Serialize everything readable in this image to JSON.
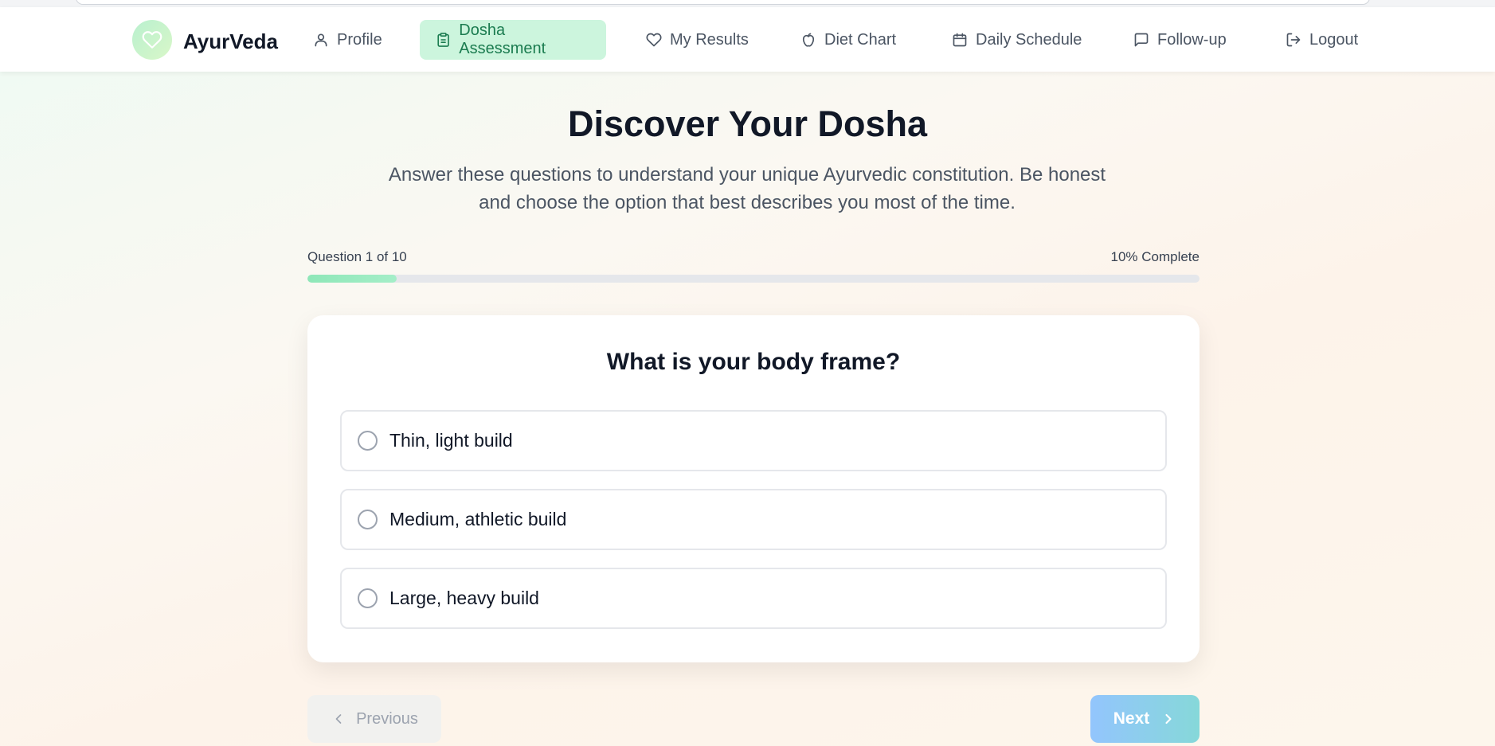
{
  "app": {
    "name": "AyurVeda"
  },
  "nav": {
    "items": [
      {
        "label": "Profile",
        "icon": "user-icon"
      },
      {
        "label": "Dosha Assessment",
        "icon": "clipboard-icon",
        "active": true
      },
      {
        "label": "My Results",
        "icon": "heart-icon"
      },
      {
        "label": "Diet Chart",
        "icon": "apple-icon"
      },
      {
        "label": "Daily Schedule",
        "icon": "calendar-icon"
      },
      {
        "label": "Follow-up",
        "icon": "message-icon"
      },
      {
        "label": "Logout",
        "icon": "logout-icon"
      }
    ]
  },
  "page": {
    "title": "Discover Your Dosha",
    "subtitle": "Answer these questions to understand your unique Ayurvedic constitution. Be honest and choose the option that best describes you most of the time."
  },
  "progress": {
    "question_label": "Question 1 of 10",
    "percent_label": "10% Complete",
    "fraction": 0.1
  },
  "question": {
    "text": "What is your body frame?",
    "options": [
      {
        "label": "Thin, light build"
      },
      {
        "label": "Medium, athletic build"
      },
      {
        "label": "Large, heavy build"
      }
    ]
  },
  "buttons": {
    "previous": "Previous",
    "next": "Next"
  },
  "colors": {
    "accent": "#1b7c50",
    "active_bg": "#ccf5dd",
    "next_start": "#93c5fd",
    "next_end": "#86d8d9"
  }
}
